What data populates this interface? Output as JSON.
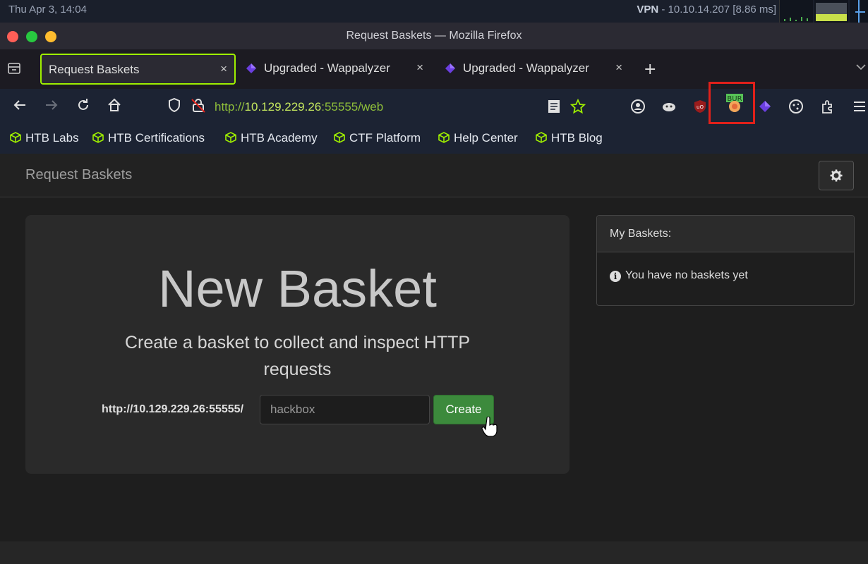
{
  "os": {
    "clock": "Thu Apr  3, 14:04",
    "vpn_label": "VPN",
    "vpn_detail": " - 10.10.14.207 [8.86 ms]"
  },
  "window": {
    "title": "Request Baskets — Mozilla Firefox"
  },
  "tabs": [
    {
      "label": "Request Baskets",
      "active": true
    },
    {
      "label": "Upgraded - Wappalyzer",
      "active": false
    },
    {
      "label": "Upgraded - Wappalyzer",
      "active": false
    }
  ],
  "tab_close_glyph": "×",
  "new_tab_glyph": "+",
  "navbar": {
    "url_scheme": "http://",
    "url_host": "10.129.229.26",
    "url_rest": ":55555/web"
  },
  "bookmarks": [
    "HTB Labs",
    "HTB Certifications",
    "HTB Academy",
    "CTF Platform",
    "Help Center",
    "HTB Blog"
  ],
  "page": {
    "brand": "Request Baskets",
    "heading": "New Basket",
    "lead": "Create a basket to collect and inspect HTTP requests",
    "url_prefix": "http://10.129.229.26:55555/",
    "basket_name_value": "hackbox",
    "create_label": "Create",
    "panel_title": "My Baskets:",
    "panel_empty": "You have no baskets yet"
  },
  "extensions": {
    "burp_badge": "BUR"
  },
  "colors": {
    "accent": "#9fef00",
    "create_button": "#3c8a3c",
    "highlight_box": "#e0201a"
  }
}
